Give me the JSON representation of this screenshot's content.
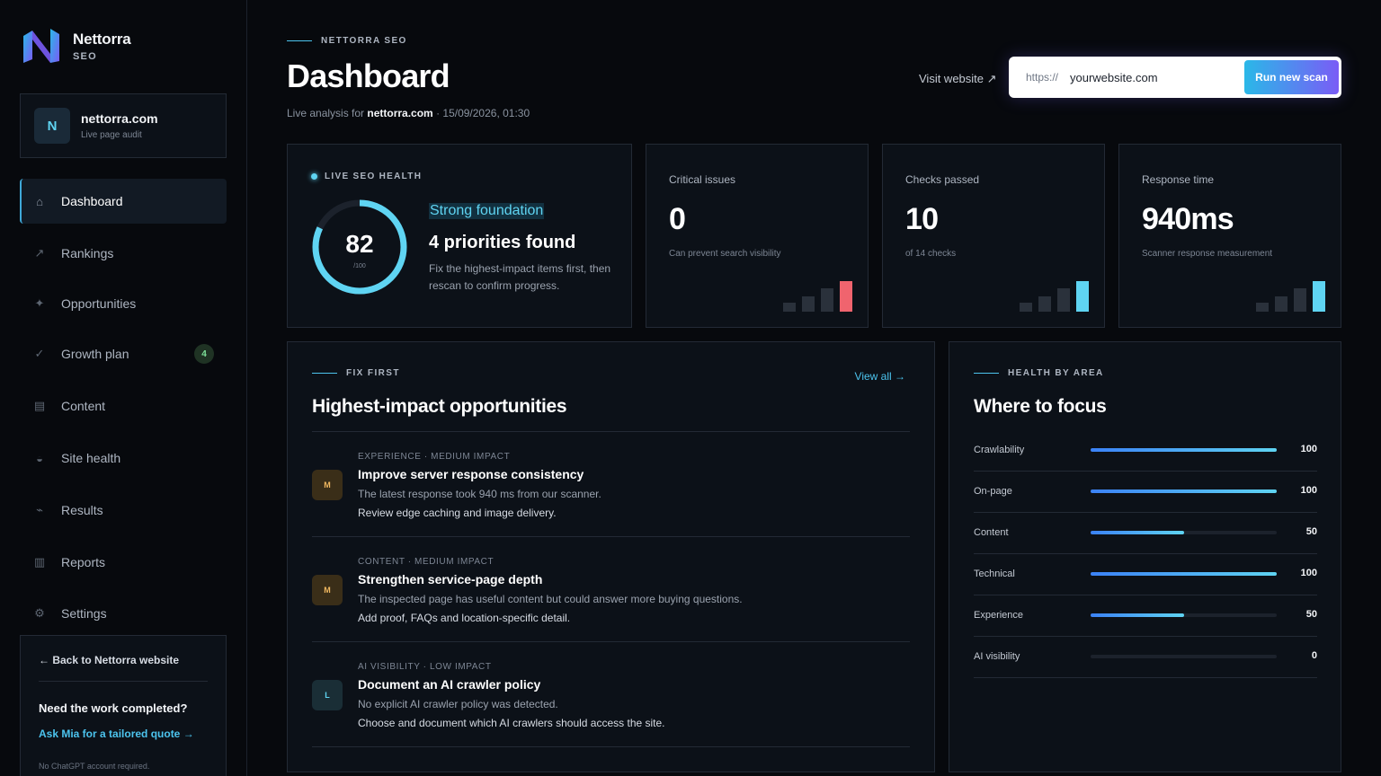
{
  "brand": {
    "name": "Nettorra",
    "sub": "SEO",
    "logo": "nettorra-n-logo"
  },
  "site": {
    "avatar": "N",
    "domain": "nettorra.com",
    "sub": "Live page audit"
  },
  "nav": [
    {
      "label": "Dashboard",
      "icon": "⌂",
      "icon_name": "home-icon",
      "active": true
    },
    {
      "label": "Rankings",
      "icon": "↗",
      "icon_name": "trend-up-icon"
    },
    {
      "label": "Opportunities",
      "icon": "✦",
      "icon_name": "sparkle-icon"
    },
    {
      "label": "Growth plan",
      "icon": "✓",
      "icon_name": "check-icon",
      "badge": "4"
    },
    {
      "label": "Content",
      "icon": "▤",
      "icon_name": "document-icon"
    },
    {
      "label": "Site health",
      "icon": "◒",
      "icon_name": "health-icon"
    },
    {
      "label": "Results",
      "icon": "⌁",
      "icon_name": "pulse-icon"
    },
    {
      "label": "Reports",
      "icon": "▥",
      "icon_name": "report-icon"
    },
    {
      "label": "Settings",
      "icon": "⚙",
      "icon_name": "gear-icon"
    }
  ],
  "sidebar_cta": {
    "back": "← Back to Nettorra website",
    "title": "Need the work completed?",
    "link": "Ask Mia for a tailored quote →",
    "note": "No ChatGPT account required."
  },
  "header": {
    "eyebrow": "NETTORRA SEO",
    "title": "Dashboard",
    "sub_prefix": "Live analysis for ",
    "sub_domain": "nettorra.com",
    "sub_suffix": " · 15/09/2026, 01:30",
    "visit": "Visit website ↗",
    "scan_prefix": "https://",
    "scan_placeholder": "yourwebsite.com",
    "scan_button": "Run new scan"
  },
  "health": {
    "label": "LIVE SEO HEALTH",
    "score": "82",
    "score_max": "/100",
    "score_fraction": 0.82,
    "status": "Strong foundation",
    "title": "4 priorities found",
    "desc": "Fix the highest-impact items first, then rescan to confirm progress."
  },
  "stats": [
    {
      "label": "Critical issues",
      "value": "0",
      "sub": "Can prevent search visibility",
      "accent": "#f0646e",
      "bars": [
        0.3,
        0.5,
        0.75,
        1.0
      ]
    },
    {
      "label": "Checks passed",
      "value": "10",
      "sub": "of 14 checks",
      "accent": "#5fd4f2",
      "bars": [
        0.3,
        0.5,
        0.75,
        1.0
      ]
    },
    {
      "label": "Response time",
      "value": "940ms",
      "sub": "Scanner response measurement",
      "accent": "#5fd4f2",
      "bars": [
        0.3,
        0.5,
        0.75,
        1.0
      ]
    }
  ],
  "opportunities": {
    "eyebrow": "FIX FIRST",
    "title": "Highest-impact opportunities",
    "view_all": "View all →",
    "items": [
      {
        "badge": "M",
        "level": "medium",
        "meta": "EXPERIENCE · MEDIUM IMPACT",
        "title": "Improve server response consistency",
        "desc": "The latest response took 940 ms from our scanner.",
        "action": "Review edge caching and image delivery."
      },
      {
        "badge": "M",
        "level": "medium",
        "meta": "CONTENT · MEDIUM IMPACT",
        "title": "Strengthen service-page depth",
        "desc": "The inspected page has useful content but could answer more buying questions.",
        "action": "Add proof, FAQs and location-specific detail."
      },
      {
        "badge": "L",
        "level": "low",
        "meta": "AI VISIBILITY · LOW IMPACT",
        "title": "Document an AI crawler policy",
        "desc": "No explicit AI crawler policy was detected.",
        "action": "Choose and document which AI crawlers should access the site."
      }
    ]
  },
  "focus": {
    "eyebrow": "HEALTH BY AREA",
    "title": "Where to focus",
    "rows": [
      {
        "label": "Crawlability",
        "value": "100",
        "pct": 100
      },
      {
        "label": "On-page",
        "value": "100",
        "pct": 100
      },
      {
        "label": "Content",
        "value": "50",
        "pct": 50
      },
      {
        "label": "Technical",
        "value": "100",
        "pct": 100
      },
      {
        "label": "Experience",
        "value": "50",
        "pct": 50
      },
      {
        "label": "AI visibility",
        "value": "0",
        "pct": 0
      }
    ]
  },
  "colors": {
    "accent": "#5fd4f2",
    "critical": "#f0646e",
    "background": "#07090d",
    "card": "#0c1118"
  }
}
